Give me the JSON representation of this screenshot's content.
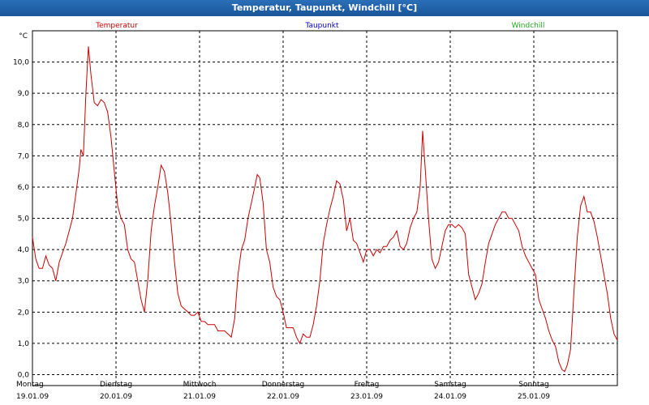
{
  "window": {
    "title": "Temperatur, Taupunkt, Windchill [°C]"
  },
  "chart_data": {
    "type": "line",
    "title": "Temperatur, Taupunkt, Windchill [°C]",
    "ylabel": "°C",
    "ylim": [
      -0.35,
      11.0
    ],
    "y_ticks": [
      "0,0",
      "1,0",
      "2,0",
      "3,0",
      "4,0",
      "5,0",
      "6,0",
      "7,0",
      "8,0",
      "9,0",
      "10,0"
    ],
    "y_tick_values": [
      0,
      1,
      2,
      3,
      4,
      5,
      6,
      7,
      8,
      9,
      10
    ],
    "x_range_days": [
      0,
      7
    ],
    "x_ticks": [
      {
        "day": "Montag",
        "date": "19.01.09"
      },
      {
        "day": "Dienstag",
        "date": "20.01.09"
      },
      {
        "day": "Mittwoch",
        "date": "21.01.09"
      },
      {
        "day": "Donnerstag",
        "date": "22.01.09"
      },
      {
        "day": "Freitag",
        "date": "23.01.09"
      },
      {
        "day": "Samstag",
        "date": "24.01.09"
      },
      {
        "day": "Sonntag",
        "date": "25.01.09"
      }
    ],
    "grid": true,
    "legend_placement": "top",
    "series": [
      {
        "name": "Temperatur",
        "color": "#cc0000",
        "points": [
          [
            0.0,
            4.4
          ],
          [
            0.04,
            3.7
          ],
          [
            0.08,
            3.4
          ],
          [
            0.12,
            3.4
          ],
          [
            0.16,
            3.8
          ],
          [
            0.2,
            3.5
          ],
          [
            0.24,
            3.4
          ],
          [
            0.28,
            3.0
          ],
          [
            0.32,
            3.6
          ],
          [
            0.36,
            3.9
          ],
          [
            0.4,
            4.2
          ],
          [
            0.44,
            4.6
          ],
          [
            0.48,
            5.0
          ],
          [
            0.52,
            5.8
          ],
          [
            0.56,
            6.6
          ],
          [
            0.58,
            7.2
          ],
          [
            0.61,
            7.0
          ],
          [
            0.64,
            9.0
          ],
          [
            0.67,
            10.5
          ],
          [
            0.7,
            9.6
          ],
          [
            0.74,
            8.7
          ],
          [
            0.78,
            8.6
          ],
          [
            0.82,
            8.8
          ],
          [
            0.86,
            8.7
          ],
          [
            0.9,
            8.4
          ],
          [
            0.94,
            7.6
          ],
          [
            0.98,
            6.5
          ],
          [
            1.02,
            5.4
          ],
          [
            1.06,
            5.0
          ],
          [
            1.1,
            4.8
          ],
          [
            1.14,
            4.0
          ],
          [
            1.18,
            3.7
          ],
          [
            1.22,
            3.6
          ],
          [
            1.26,
            3.0
          ],
          [
            1.3,
            2.4
          ],
          [
            1.34,
            2.0
          ],
          [
            1.38,
            3.0
          ],
          [
            1.42,
            4.6
          ],
          [
            1.46,
            5.4
          ],
          [
            1.5,
            6.0
          ],
          [
            1.54,
            6.7
          ],
          [
            1.58,
            6.5
          ],
          [
            1.62,
            5.8
          ],
          [
            1.66,
            4.8
          ],
          [
            1.7,
            3.6
          ],
          [
            1.74,
            2.6
          ],
          [
            1.78,
            2.2
          ],
          [
            1.82,
            2.1
          ],
          [
            1.86,
            2.0
          ],
          [
            1.9,
            1.9
          ],
          [
            1.94,
            1.9
          ],
          [
            1.98,
            2.0
          ],
          [
            2.02,
            1.7
          ],
          [
            2.06,
            1.7
          ],
          [
            2.1,
            1.6
          ],
          [
            2.14,
            1.6
          ],
          [
            2.18,
            1.6
          ],
          [
            2.22,
            1.4
          ],
          [
            2.26,
            1.4
          ],
          [
            2.3,
            1.4
          ],
          [
            2.34,
            1.3
          ],
          [
            2.38,
            1.2
          ],
          [
            2.42,
            1.8
          ],
          [
            2.46,
            3.2
          ],
          [
            2.5,
            4.0
          ],
          [
            2.54,
            4.3
          ],
          [
            2.58,
            5.0
          ],
          [
            2.62,
            5.5
          ],
          [
            2.66,
            6.0
          ],
          [
            2.69,
            6.4
          ],
          [
            2.72,
            6.3
          ],
          [
            2.76,
            5.5
          ],
          [
            2.8,
            4.0
          ],
          [
            2.84,
            3.6
          ],
          [
            2.88,
            2.8
          ],
          [
            2.92,
            2.5
          ],
          [
            2.96,
            2.4
          ],
          [
            3.0,
            2.0
          ],
          [
            3.04,
            1.5
          ],
          [
            3.08,
            1.5
          ],
          [
            3.12,
            1.5
          ],
          [
            3.16,
            1.2
          ],
          [
            3.2,
            1.0
          ],
          [
            3.24,
            1.3
          ],
          [
            3.28,
            1.2
          ],
          [
            3.32,
            1.2
          ],
          [
            3.36,
            1.6
          ],
          [
            3.4,
            2.2
          ],
          [
            3.44,
            3.0
          ],
          [
            3.48,
            4.2
          ],
          [
            3.52,
            4.8
          ],
          [
            3.56,
            5.3
          ],
          [
            3.6,
            5.7
          ],
          [
            3.64,
            6.2
          ],
          [
            3.68,
            6.1
          ],
          [
            3.72,
            5.6
          ],
          [
            3.76,
            4.6
          ],
          [
            3.8,
            5.0
          ],
          [
            3.84,
            4.3
          ],
          [
            3.88,
            4.2
          ],
          [
            3.92,
            3.9
          ],
          [
            3.96,
            3.6
          ],
          [
            4.0,
            4.0
          ],
          [
            4.04,
            4.0
          ],
          [
            4.08,
            3.8
          ],
          [
            4.12,
            4.0
          ],
          [
            4.16,
            3.9
          ],
          [
            4.2,
            4.1
          ],
          [
            4.24,
            4.1
          ],
          [
            4.28,
            4.3
          ],
          [
            4.32,
            4.4
          ],
          [
            4.36,
            4.6
          ],
          [
            4.4,
            4.1
          ],
          [
            4.44,
            4.0
          ],
          [
            4.48,
            4.2
          ],
          [
            4.52,
            4.7
          ],
          [
            4.56,
            5.0
          ],
          [
            4.6,
            5.2
          ],
          [
            4.64,
            6.0
          ],
          [
            4.67,
            7.8
          ],
          [
            4.7,
            6.6
          ],
          [
            4.74,
            5.0
          ],
          [
            4.78,
            3.7
          ],
          [
            4.82,
            3.4
          ],
          [
            4.86,
            3.6
          ],
          [
            4.9,
            4.1
          ],
          [
            4.94,
            4.6
          ],
          [
            4.98,
            4.8
          ],
          [
            5.02,
            4.8
          ],
          [
            5.06,
            4.7
          ],
          [
            5.1,
            4.8
          ],
          [
            5.14,
            4.7
          ],
          [
            5.18,
            4.5
          ],
          [
            5.22,
            3.2
          ],
          [
            5.26,
            2.8
          ],
          [
            5.3,
            2.4
          ],
          [
            5.34,
            2.6
          ],
          [
            5.38,
            2.9
          ],
          [
            5.42,
            3.6
          ],
          [
            5.46,
            4.2
          ],
          [
            5.5,
            4.5
          ],
          [
            5.54,
            4.8
          ],
          [
            5.58,
            5.0
          ],
          [
            5.62,
            5.2
          ],
          [
            5.66,
            5.2
          ],
          [
            5.7,
            5.0
          ],
          [
            5.74,
            5.0
          ],
          [
            5.78,
            4.8
          ],
          [
            5.82,
            4.6
          ],
          [
            5.86,
            4.1
          ],
          [
            5.9,
            3.8
          ],
          [
            5.94,
            3.6
          ],
          [
            5.98,
            3.4
          ],
          [
            6.02,
            3.2
          ],
          [
            6.06,
            2.4
          ],
          [
            6.1,
            2.1
          ],
          [
            6.14,
            1.8
          ],
          [
            6.18,
            1.4
          ],
          [
            6.22,
            1.1
          ],
          [
            6.26,
            0.9
          ],
          [
            6.3,
            0.4
          ],
          [
            6.34,
            0.15
          ],
          [
            6.37,
            0.1
          ],
          [
            6.4,
            0.3
          ],
          [
            6.44,
            0.8
          ],
          [
            6.48,
            2.6
          ],
          [
            6.52,
            4.4
          ],
          [
            6.56,
            5.4
          ],
          [
            6.6,
            5.7
          ],
          [
            6.64,
            5.2
          ],
          [
            6.68,
            5.2
          ],
          [
            6.72,
            4.9
          ],
          [
            6.76,
            4.4
          ],
          [
            6.8,
            3.8
          ],
          [
            6.84,
            3.2
          ],
          [
            6.88,
            2.6
          ],
          [
            6.92,
            1.8
          ],
          [
            6.96,
            1.3
          ],
          [
            7.0,
            1.1
          ]
        ]
      },
      {
        "name": "Taupunkt",
        "color": "#0000cc",
        "points": []
      },
      {
        "name": "Windchill",
        "color": "#22aa22",
        "points": []
      }
    ]
  }
}
